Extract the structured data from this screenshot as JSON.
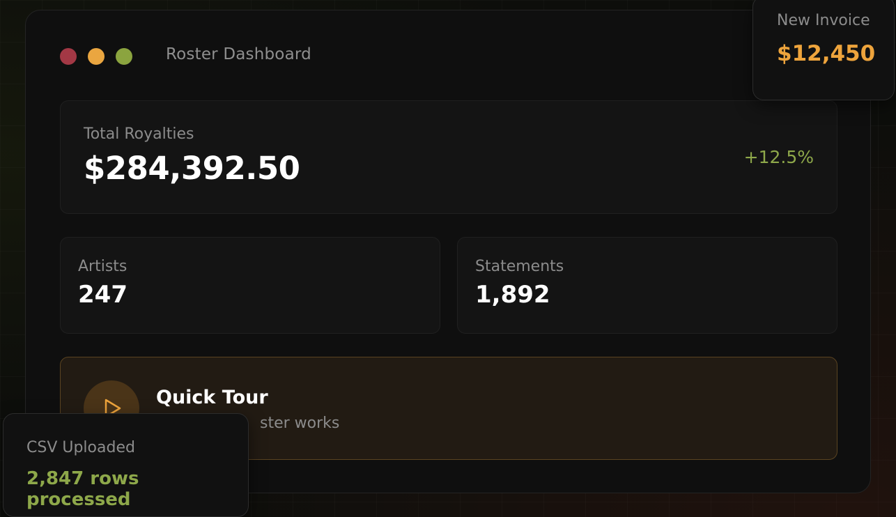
{
  "window": {
    "title": "Roster Dashboard"
  },
  "royalties": {
    "label": "Total Royalties",
    "value": "$284,392.50",
    "change": "+12.5%"
  },
  "stats": [
    {
      "label": "Artists",
      "value": "247"
    },
    {
      "label": "Statements",
      "value": "1,892"
    }
  ],
  "tour": {
    "title": "Quick Tour",
    "subtitle": "ster works",
    "icon": "play-icon"
  },
  "toasts": {
    "invoice": {
      "label": "New Invoice",
      "value": "$12,450"
    },
    "csv": {
      "label": "CSV Uploaded",
      "value": "2,847 rows processed"
    }
  },
  "colors": {
    "accent_orange": "#eea43c",
    "accent_green": "#8ea84a",
    "dot_red": "#a33845",
    "dot_yellow": "#eaa640",
    "dot_green": "#8ba43f"
  }
}
